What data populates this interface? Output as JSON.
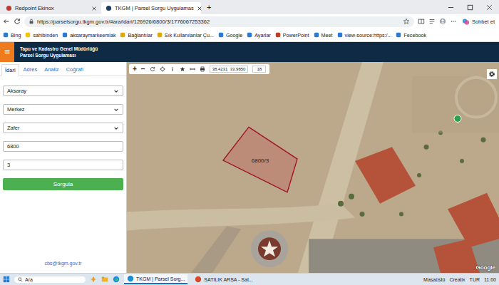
{
  "browser": {
    "tabs": [
      {
        "label": "Redpoint Ekinox",
        "selected": false
      },
      {
        "label": "TKGM | Parsel Sorgu Uygulamas",
        "selected": true
      }
    ],
    "new_tab": "+",
    "url": "https://parselsorgu.tkgm.gov.tr/#ara/idari/126926/6800/3/1776067253362",
    "copilot": "Sohbet et",
    "bookmarks": [
      {
        "label": "Bing",
        "color": "#2b7bd6"
      },
      {
        "label": "sahibinden",
        "color": "#f5c400"
      },
      {
        "label": "aksaraymarkeemlak",
        "color": "#2b7bd6"
      },
      {
        "label": "Bağlantılar",
        "color": "#e0a800"
      },
      {
        "label": "Sık Kullanılanlar Çu...",
        "color": "#e0a800"
      },
      {
        "label": "Google",
        "color": "#2b7bd6"
      },
      {
        "label": "Ayarlar",
        "color": "#2b7bd6"
      },
      {
        "label": "PowerPoint",
        "color": "#c43e1c"
      },
      {
        "label": "Meet",
        "color": "#2b7bd6"
      },
      {
        "label": "view-source:https:/...",
        "color": "#2b7bd6"
      },
      {
        "label": "Fecebook",
        "color": "#2b7bd6"
      }
    ]
  },
  "app": {
    "title": "Tapu ve Kadastro Genel Müdürlüğü",
    "subtitle": "Parsel Sorgu Uygulaması"
  },
  "panel": {
    "tabs": [
      {
        "label": "İdari",
        "selected": true
      },
      {
        "label": "Adres",
        "selected": false
      },
      {
        "label": "Analiz",
        "selected": false
      },
      {
        "label": "Coğrafi",
        "selected": false
      }
    ],
    "fields": [
      {
        "kind": "select",
        "value": "Aksaray"
      },
      {
        "kind": "select",
        "value": "Merkez"
      },
      {
        "kind": "select",
        "value": "Zafer"
      },
      {
        "kind": "input",
        "value": "6800"
      },
      {
        "kind": "input",
        "value": "3"
      }
    ],
    "button": "Sorgula",
    "footer": "cbs@tkgm.gov.tr"
  },
  "map": {
    "zoom_in": "+",
    "zoom_out": "−",
    "coords": "38.4231  33.9850",
    "zoom": "18",
    "parcel": "6800/3",
    "attribution": "Google"
  },
  "taskbar": {
    "search": "Ara",
    "apps": [
      {
        "label": "TKGM | Parsel Sorg...",
        "selected": true
      },
      {
        "label": "SATILIK ARSA - Sat...",
        "selected": false
      }
    ],
    "desktop": "Masaüstü",
    "weather": "Creatix",
    "lang": "TUR",
    "time": "11:00"
  }
}
